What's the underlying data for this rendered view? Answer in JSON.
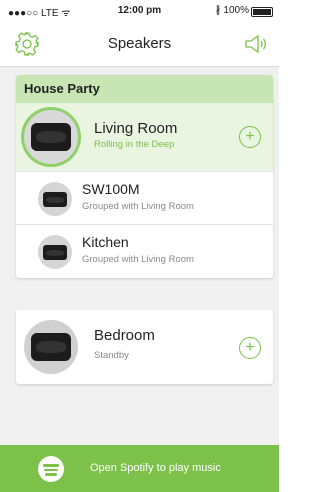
{
  "status_bar": {
    "carrier": "●●●○○ LTE ᯤ",
    "time": "12:00 pm",
    "battery": "∦ 100%",
    "battery_level": 1.0
  },
  "navbar": {
    "title": "Speakers",
    "settings_icon": "gear-icon",
    "volume_icon": "volume-icon"
  },
  "group": {
    "title": "House Party",
    "active_speaker": {
      "name": "Living Room",
      "status": "Rolling in the Deep"
    },
    "members": [
      {
        "name": "SW100M",
        "status": "Grouped with Living Room"
      },
      {
        "name": "Kitchen",
        "status": "Grouped with Living Room"
      }
    ]
  },
  "standalone": {
    "name": "Bedroom",
    "status": "Standby"
  },
  "plus_symbol": "+",
  "footer": {
    "text": "Open Spotify to play music",
    "icon": "spotify-icon"
  },
  "colors": {
    "accent": "#7bc14a",
    "group_header": "#c8e6b4"
  }
}
